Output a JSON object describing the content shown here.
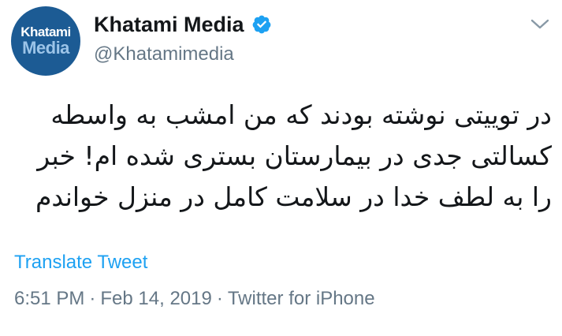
{
  "avatar": {
    "line1": "Khatami",
    "line2": "Media",
    "bg_color": "#1c5b94"
  },
  "author": {
    "display_name": "Khatami Media",
    "handle": "@Khatamimedia",
    "verified": true,
    "verified_icon": "verified-badge-icon"
  },
  "menu": {
    "icon": "chevron-down-icon"
  },
  "tweet": {
    "text": "در توییتی نوشته بودند که من امشب به واسطه\nکسالتی جدی در بیمارستان بستری شده ام! خبر\nرا به لطف خدا در سلامت کامل در منزل خواندم"
  },
  "translate": {
    "label": "Translate Tweet"
  },
  "meta": {
    "time": "6:51 PM",
    "separator": "·",
    "date": "Feb 14, 2019",
    "source": "Twitter for iPhone"
  },
  "colors": {
    "link": "#1da1f2",
    "secondary_text": "#657786",
    "primary_text": "#14171a"
  }
}
